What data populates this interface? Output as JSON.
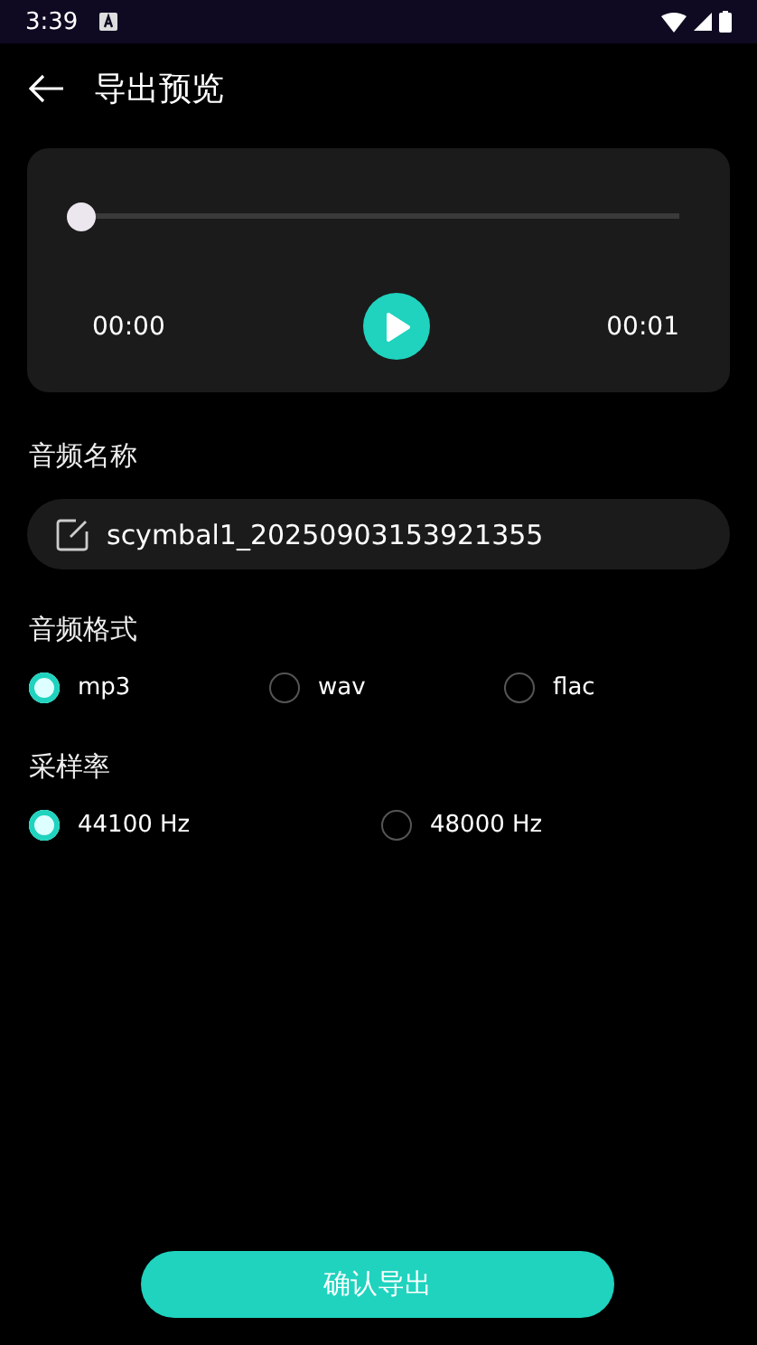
{
  "status_bar": {
    "time": "3:39"
  },
  "header": {
    "title": "导出预览"
  },
  "player": {
    "level": 0.0,
    "current_time": "00:00",
    "total_time": "00:01",
    "playing": false
  },
  "name_section": {
    "label": "音频名称",
    "value": "scymbal1_20250903153921355"
  },
  "format_section": {
    "label": "音频格式",
    "options": [
      {
        "label": "mp3",
        "selected": true
      },
      {
        "label": "wav",
        "selected": false
      },
      {
        "label": "flac",
        "selected": false
      }
    ]
  },
  "rate_section": {
    "label": "采样率",
    "options": [
      {
        "label": "44100 Hz",
        "selected": true
      },
      {
        "label": "48000 Hz",
        "selected": false
      }
    ]
  },
  "confirm_button": {
    "label": "确认导出"
  }
}
